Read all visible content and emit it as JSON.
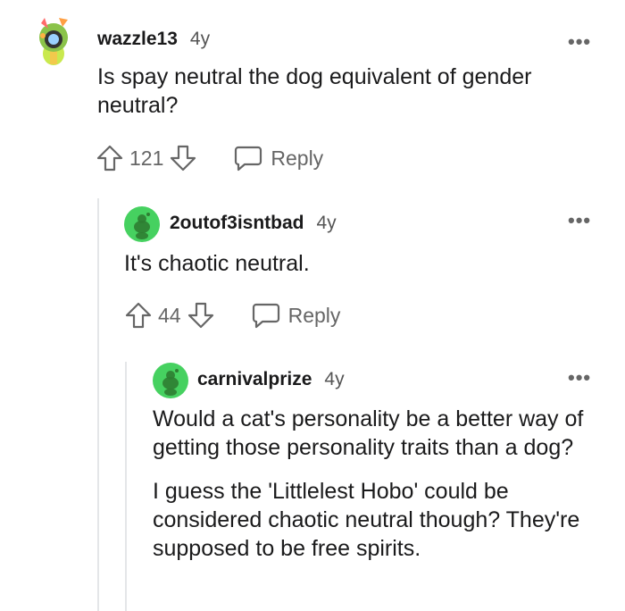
{
  "comments": [
    {
      "username": "wazzle13",
      "age": "4y",
      "paragraphs": [
        "Is spay neutral the dog equivalent of gender neutral?"
      ],
      "score": "121",
      "reply_label": "Reply",
      "more_label": "•••"
    },
    {
      "username": "2outof3isntbad",
      "age": "4y",
      "paragraphs": [
        "It's chaotic neutral."
      ],
      "score": "44",
      "reply_label": "Reply",
      "more_label": "•••"
    },
    {
      "username": "carnivalprize",
      "age": "4y",
      "paragraphs": [
        "Would a cat's personality be a better way of getting those personality traits than a dog?",
        "I guess the 'Littlelest Hobo' could be considered chaotic neutral though? They're supposed to be free spirits."
      ],
      "more_label": "•••"
    }
  ],
  "colors": {
    "text": "#1a1a1b",
    "muted": "#666666",
    "thread_line": "#e4e6e8",
    "avatar_green": "#46d160"
  }
}
